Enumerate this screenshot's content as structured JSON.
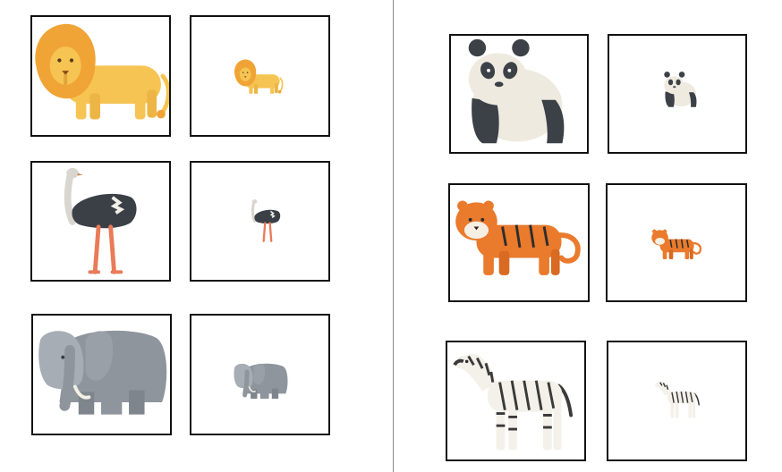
{
  "worksheet": {
    "title": "",
    "instructions": "",
    "pairs": [
      {
        "animal": "lion",
        "big_icon": "lion-icon",
        "small_icon": "lion-icon"
      },
      {
        "animal": "ostrich",
        "big_icon": "ostrich-icon",
        "small_icon": "ostrich-icon"
      },
      {
        "animal": "elephant",
        "big_icon": "elephant-icon",
        "small_icon": "elephant-icon"
      },
      {
        "animal": "panda",
        "big_icon": "panda-icon",
        "small_icon": "panda-icon"
      },
      {
        "animal": "tiger",
        "big_icon": "tiger-icon",
        "small_icon": "tiger-icon"
      },
      {
        "animal": "zebra",
        "big_icon": "zebra-icon",
        "small_icon": "zebra-icon"
      }
    ]
  },
  "colors": {
    "lion_body": "#f6c452",
    "lion_mane": "#f0a436",
    "ostrich_body": "#3b4047",
    "ostrich_legs": "#ea7a58",
    "elephant_body": "#8f959d",
    "panda_black": "#3c4047",
    "tiger_orange": "#ea7a2c",
    "zebra_white": "#f3f1ea",
    "card_border": "#111111",
    "divider": "#8a8a8a"
  }
}
